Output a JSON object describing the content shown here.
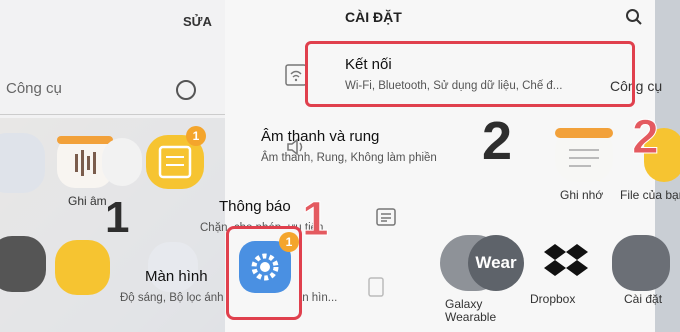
{
  "left_panel": {
    "edit_label": "SỬA",
    "tools_label": "Công cụ",
    "recorder_label": "Ghi âm"
  },
  "settings": {
    "title": "CÀI ĐẶT",
    "items": [
      {
        "title": "Kết nối",
        "subtitle": "Wi-Fi, Bluetooth, Sử dụng dữ liệu, Chế đ...",
        "icon": "wifi-icon"
      },
      {
        "title": "Âm thanh và rung",
        "subtitle": "Âm thanh, Rung, Không làm phiền",
        "icon": "speaker-icon"
      },
      {
        "title": "Thông báo",
        "subtitle": "Chặn, cho phép, ưu tiên",
        "icon": "notification-icon"
      },
      {
        "title": "Màn hình",
        "subtitle": "Độ sáng, Bộ lọc ánh sáng xanh, Màn hìn...",
        "icon": "display-icon"
      }
    ]
  },
  "annotations": {
    "step1_left": "1",
    "step1_red": "1",
    "step2_dark": "2",
    "step2_red": "2"
  },
  "apps": {
    "notes": "Ghi nhớ",
    "my_files": "File của bạn",
    "galaxy_wearable": "Galaxy\nWearable",
    "dropbox": "Dropbox",
    "settings": "Cài đặt",
    "wear_text": "Wear",
    "right_tools": "Công cụ",
    "badge_1": "1"
  },
  "colors": {
    "highlight": "#e0404d",
    "badge": "#f4a52c",
    "settings_blue": "#4a90e2"
  }
}
